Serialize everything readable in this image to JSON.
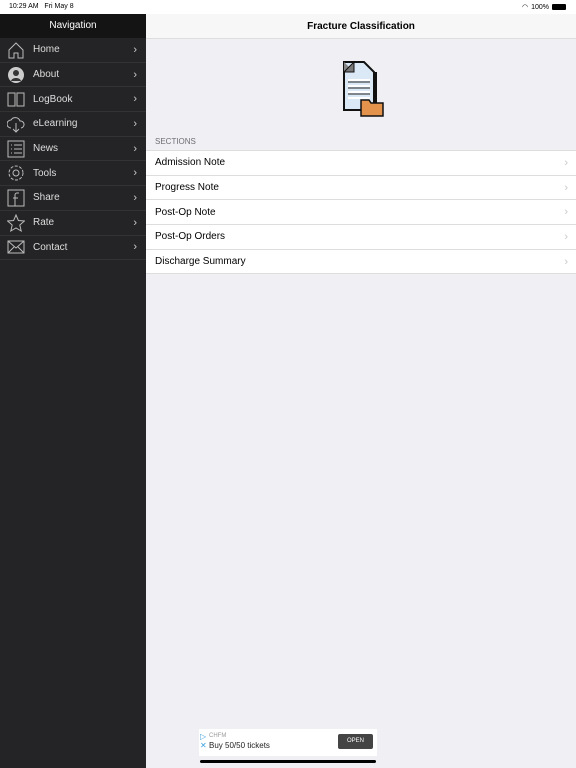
{
  "status": {
    "time": "10:29 AM",
    "date": "Fri May 8",
    "battery": "100%"
  },
  "sidebar": {
    "title": "Navigation",
    "items": [
      {
        "label": "Home",
        "icon": "home-icon"
      },
      {
        "label": "About",
        "icon": "person-icon"
      },
      {
        "label": "LogBook",
        "icon": "book-icon"
      },
      {
        "label": "eLearning",
        "icon": "cloud-download-icon"
      },
      {
        "label": "News",
        "icon": "list-icon"
      },
      {
        "label": "Tools",
        "icon": "gear-icon"
      },
      {
        "label": "Share",
        "icon": "facebook-icon"
      },
      {
        "label": "Rate",
        "icon": "star-icon"
      },
      {
        "label": "Contact",
        "icon": "mail-icon"
      }
    ]
  },
  "main": {
    "title": "Fracture Classification",
    "section_header": "SECTIONS",
    "rows": [
      "Admission Note",
      "Progress Note",
      "Post-Op Note",
      "Post-Op Orders",
      "Discharge Summary"
    ]
  },
  "ad": {
    "brand": "CHFM",
    "message": "Buy 50/50 tickets",
    "button": "OPEN"
  }
}
